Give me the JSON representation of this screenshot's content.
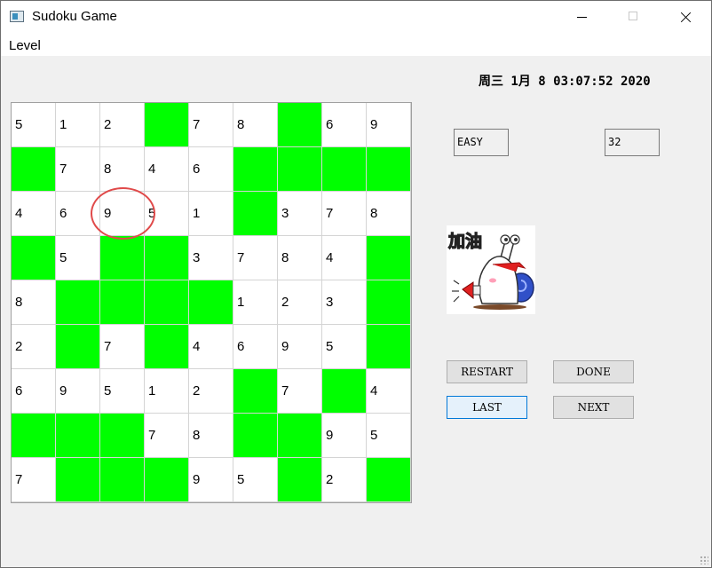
{
  "window": {
    "title": "Sudoku Game"
  },
  "menu": {
    "items": [
      "Level"
    ]
  },
  "datetime": "周三 1月 8 03:07:52 2020",
  "board": [
    [
      "5",
      "1",
      "2",
      "",
      "7",
      "8",
      "",
      "6",
      "9"
    ],
    [
      "",
      "7",
      "8",
      "4",
      "6",
      "",
      "",
      "",
      ""
    ],
    [
      "4",
      "6",
      "9",
      "5",
      "1",
      "",
      "3",
      "7",
      "8"
    ],
    [
      "",
      "5",
      "",
      "",
      "3",
      "7",
      "8",
      "4",
      ""
    ],
    [
      "8",
      "",
      "",
      "",
      "",
      "1",
      "2",
      "3",
      ""
    ],
    [
      "2",
      "",
      "7",
      "",
      "4",
      "6",
      "9",
      "5",
      ""
    ],
    [
      "6",
      "9",
      "5",
      "1",
      "2",
      "",
      "7",
      "",
      "4"
    ],
    [
      "",
      "",
      "",
      "7",
      "8",
      "",
      "",
      "9",
      "5"
    ],
    [
      "7",
      "",
      "",
      "",
      "9",
      "5",
      "",
      "2",
      ""
    ]
  ],
  "blank_color": "#00ff00",
  "selected_cell": {
    "row": 3,
    "col": 3,
    "value": "9"
  },
  "level_field": "EASY",
  "count_field": "32",
  "mascot": {
    "text": "加油",
    "icon": "snail-cheer-icon"
  },
  "buttons": {
    "restart": "RESTART",
    "done": "DONE",
    "last": "LAST",
    "next": "NEXT"
  }
}
